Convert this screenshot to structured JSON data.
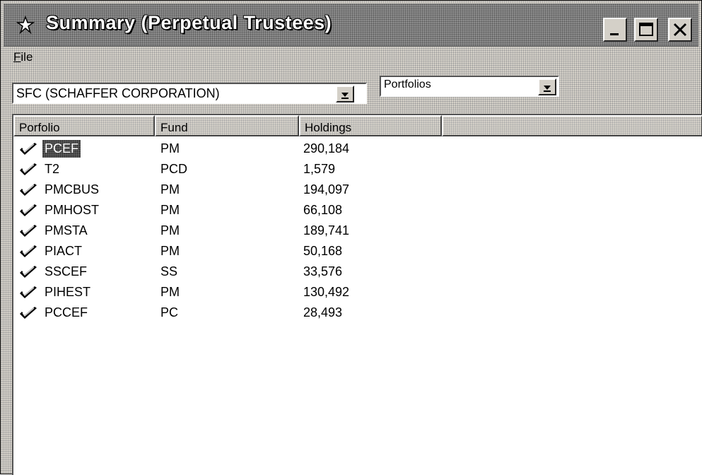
{
  "window": {
    "title": "Summary (Perpetual Trustees)",
    "controls": [
      "minimize",
      "maximize",
      "close"
    ]
  },
  "menu": {
    "file_prefix": "F",
    "file_rest": "ile"
  },
  "company_select": {
    "value": "SFC (SCHAFFER CORPORATION)"
  },
  "view_select": {
    "value": "Portfolios"
  },
  "table": {
    "columns": [
      "Porfolio",
      "Fund",
      "Holdings"
    ],
    "rows": [
      {
        "portfolio": "PCEF",
        "fund": "PM",
        "holdings": "290,184",
        "selected": true
      },
      {
        "portfolio": "T2",
        "fund": "PCD",
        "holdings": "1,579"
      },
      {
        "portfolio": "PMCBUS",
        "fund": "PM",
        "holdings": "194,097"
      },
      {
        "portfolio": "PMHOST",
        "fund": "PM",
        "holdings": "66,108"
      },
      {
        "portfolio": "PMSTA",
        "fund": "PM",
        "holdings": "189,741"
      },
      {
        "portfolio": "PIACT",
        "fund": "PM",
        "holdings": "50,168"
      },
      {
        "portfolio": "SSCEF",
        "fund": "SS",
        "holdings": "33,576"
      },
      {
        "portfolio": "PIHEST",
        "fund": "PM",
        "holdings": "130,492"
      },
      {
        "portfolio": "PCCEF",
        "fund": "PC",
        "holdings": "28,493"
      }
    ]
  },
  "icons": {
    "row_icon": "checkmark-icon",
    "app_icon": "app-icon"
  }
}
